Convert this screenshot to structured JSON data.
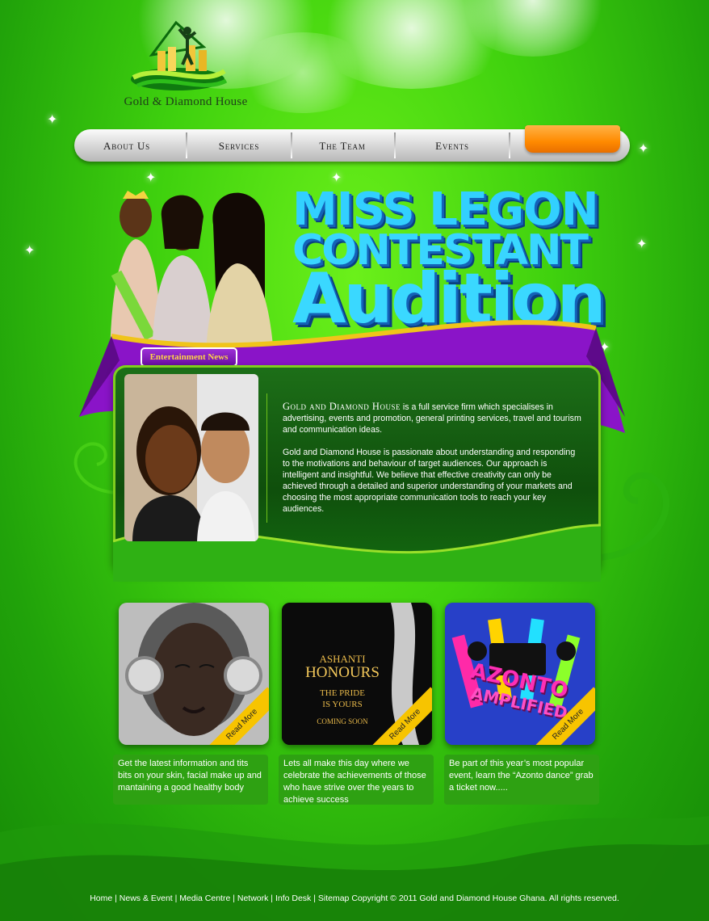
{
  "brand": {
    "name": "Gold & Diamond House"
  },
  "nav": {
    "items": [
      {
        "label": "About Us"
      },
      {
        "label": "Services"
      },
      {
        "label": "The Team"
      },
      {
        "label": "Events"
      }
    ]
  },
  "banner": {
    "line1": "MISS LEGON",
    "line2": "CONTESTANT",
    "line3": "Audition"
  },
  "section_tab": "Entertainment News",
  "about": {
    "company": "Gold and Diamond House",
    "para1_rest": " is a full service firm which specialises in advertising, events and promotion, general printing services, travel and tourism and communication ideas.",
    "para2": "Gold and Diamond House is passionate about understanding and responding to the motivations and behaviour of target audiences. Our approach is intelligent and insightful. We believe that effective creativity can only be achieved through a detailed and superior understanding of your markets and choosing the most appropriate communication tools to reach your key audiences."
  },
  "cards": [
    {
      "read_more": "Read More",
      "caption": "Get the latest information and tits bits on your skin, facial make up and mantaining a good healthy body"
    },
    {
      "read_more": "Read More",
      "caption": "Lets all make this day where we celebrate the achievements of those who have strive over the years to achieve success",
      "poster": {
        "line1": "ASHANTI",
        "line2": "HONOURS",
        "line3": "THE PRIDE",
        "line4": "IS YOURS",
        "line5": "COMING SOON"
      }
    },
    {
      "read_more": "Read More",
      "caption": "Be part of this year’s most popular event, learn the “Azonto dance” grab a ticket now.....",
      "poster": {
        "line1": "AZONTO",
        "line2": "AMPLIFIED"
      }
    }
  ],
  "footer": {
    "links": [
      "Home",
      "News & Event",
      "Media Centre",
      "Network",
      "Info Desk",
      "Sitemap"
    ],
    "copyright": "Copyright © 2011 Gold and Diamond House Ghana. All rights reserved."
  },
  "colors": {
    "background": "#3fd10e",
    "panel": "#0f4f0c",
    "ribbon": "#8a14c8",
    "nav_accent": "#ff8a00",
    "read_more": "#f7c400"
  }
}
